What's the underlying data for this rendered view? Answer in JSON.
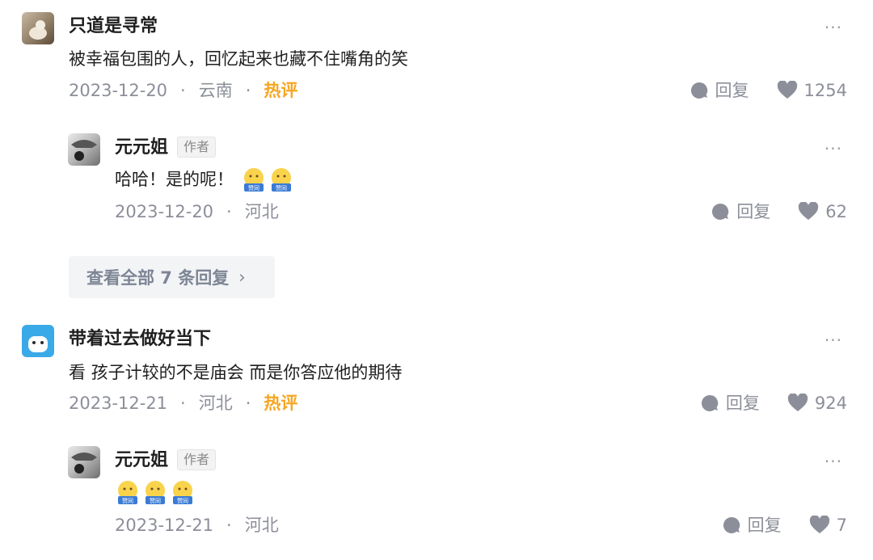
{
  "reply_label": "回复",
  "more_label": "···",
  "author_tag": "作者",
  "emoji_label": "赞同",
  "colors": {
    "accent_hot": "#f5a623",
    "meta": "#8c8f99"
  },
  "comments": [
    {
      "nick": "只道是寻常",
      "text": "被幸福包围的人，回忆起来也藏不住嘴角的笑",
      "date": "2023-12-20",
      "location": "云南",
      "badge": "热评",
      "likes": "1254"
    },
    {
      "nick": "元元姐",
      "text": "哈哈！是的呢！",
      "date": "2023-12-20",
      "location": "河北",
      "likes": "62"
    },
    {
      "nick": "带着过去做好当下",
      "text": "看 孩子计较的不是庙会 而是你答应他的期待",
      "date": "2023-12-21",
      "location": "河北",
      "badge": "热评",
      "likes": "924"
    },
    {
      "nick": "元元姐",
      "text": "",
      "date": "2023-12-21",
      "location": "河北",
      "likes": "7"
    }
  ],
  "view_all": {
    "label": "查看全部 7 条回复",
    "chevron": "›"
  }
}
